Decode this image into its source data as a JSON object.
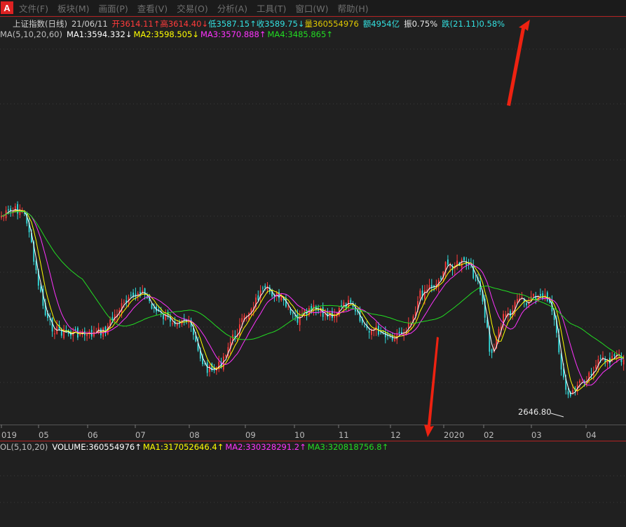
{
  "menu": {
    "logo": "A",
    "items": [
      "文件(F)",
      "板块(M)",
      "画面(P)",
      "查看(V)",
      "交易(O)",
      "分析(A)",
      "工具(T)",
      "窗口(W)",
      "帮助(H)"
    ]
  },
  "quote": {
    "name": "上证指数(日线)",
    "date": "21/06/11",
    "open": "开3614.11↑",
    "high": "高3614.40↓",
    "low": "低3587.15↑",
    "close": "收3589.75↓",
    "volume": "量360554976",
    "amount": "额4954亿",
    "amplitude": "振0.75%",
    "change": "跌(21.11)0.58%"
  },
  "ma": {
    "label": "MA(5,10,20,60)",
    "ma1": "MA1:3594.332↓",
    "ma2": "MA2:3598.505↓",
    "ma3": "MA3:3570.888↑",
    "ma4": "MA4:3485.865↑"
  },
  "vol": {
    "label": "OL(5,10,20)",
    "volume": "VOLUME:360554976↑",
    "ma1": "MA1:317052646.4↑",
    "ma2": "MA2:330328291.2↑",
    "ma3": "MA3:320818756.8↑"
  },
  "xaxis": [
    "019",
    "05",
    "06",
    "07",
    "08",
    "09",
    "10",
    "11",
    "12",
    "2020",
    "02",
    "03",
    "04"
  ],
  "annotation_low": "2646.80",
  "colors": {
    "up": "#ff3b3b",
    "down": "#33e0e0",
    "ma1": "#ffffff",
    "ma2": "#ffff00",
    "ma3": "#ff33ff",
    "ma4": "#22dd22",
    "arrow": "#ee2211"
  }
}
